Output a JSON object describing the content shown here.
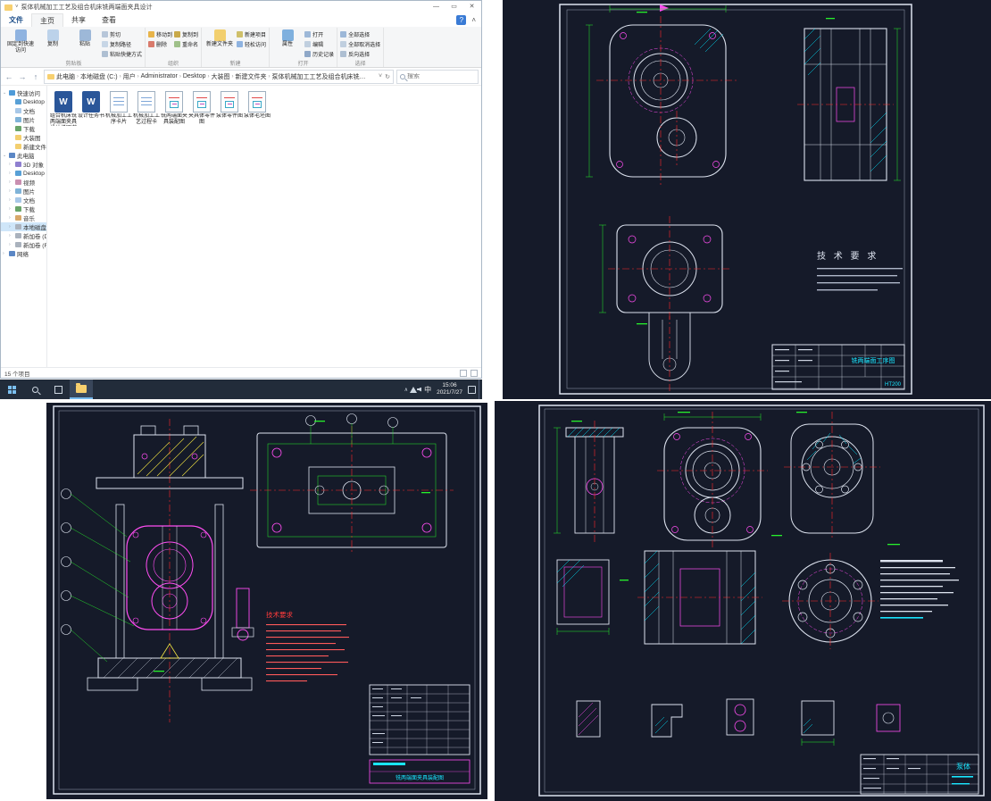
{
  "icons": {
    "minimize": "—",
    "maximize": "▭",
    "close": "✕",
    "back": "←",
    "forward": "→",
    "up": "↑",
    "refresh": "↻",
    "dropdown": "˅",
    "ribbon_collapse": "˄",
    "help": "?",
    "chevron": "›",
    "tray_arrow": "∧"
  },
  "window": {
    "title": "泵体机械加工工艺及组合机床铣两端面夹具设计"
  },
  "ribbon": {
    "file_tab": "文件",
    "tabs": [
      "主页",
      "共享",
      "查看"
    ],
    "clipboard": {
      "label": "剪贴板",
      "pin": "固定到快速访问",
      "copy": "复制",
      "paste": "粘贴",
      "cut": "剪切",
      "copy_path": "复制路径",
      "paste_shortcut": "粘贴快捷方式"
    },
    "organize": {
      "label": "组织",
      "move": "移动到",
      "copy_to": "复制到",
      "delete": "删除",
      "rename": "重命名"
    },
    "new": {
      "label": "新建",
      "new_folder": "新建文件夹",
      "new_item": "新建项目",
      "easy_access": "轻松访问"
    },
    "open": {
      "label": "打开",
      "properties": "属性",
      "open": "打开",
      "edit": "编辑",
      "history": "历史记录"
    },
    "select": {
      "label": "选择",
      "select_all": "全部选择",
      "select_none": "全部取消选择",
      "invert": "反向选择"
    }
  },
  "address": {
    "path": [
      "此电脑",
      "本地磁盘 (C:)",
      "用户",
      "Administrator",
      "Desktop",
      "大装图",
      "新建文件夹",
      "泵体机械加工工艺及组合机床铣两端面夹具设计"
    ],
    "search_placeholder": "搜索"
  },
  "nav": {
    "items": [
      {
        "label": "快速访问",
        "arr": "⌄"
      },
      {
        "label": "Desktop",
        "arr": ""
      },
      {
        "label": "文档",
        "arr": ""
      },
      {
        "label": "图片",
        "arr": ""
      },
      {
        "label": "下载",
        "arr": ""
      },
      {
        "label": "大装图",
        "arr": ""
      },
      {
        "label": "新建文件夹",
        "arr": ""
      },
      {
        "label": "此电脑",
        "arr": "⌄"
      },
      {
        "label": "3D 对象",
        "arr": "›"
      },
      {
        "label": "Desktop",
        "arr": "›"
      },
      {
        "label": "视频",
        "arr": "›"
      },
      {
        "label": "图片",
        "arr": "›"
      },
      {
        "label": "文档",
        "arr": "›"
      },
      {
        "label": "下载",
        "arr": "›"
      },
      {
        "label": "音乐",
        "arr": "›"
      },
      {
        "label": "本地磁盘 (C:)",
        "arr": "›"
      },
      {
        "label": "新加卷 (D:)",
        "arr": "›"
      },
      {
        "label": "新加卷 (F:)",
        "arr": "›"
      },
      {
        "label": "网络",
        "arr": "›"
      }
    ]
  },
  "files": [
    {
      "name": "组合机床铣两端面夹具设计说明书",
      "badge": "W"
    },
    {
      "name": "设计任务书",
      "badge": "W"
    },
    {
      "name": "机械加工工序卡片"
    },
    {
      "name": "机械加工工艺过程卡"
    },
    {
      "name": "铣两端面夹具装配图"
    },
    {
      "name": "夹具体零件图"
    },
    {
      "name": "泵体零件图"
    },
    {
      "name": "泵体毛坯图"
    }
  ],
  "statusbar": {
    "count": "15 个项目"
  },
  "taskbar": {
    "lang": "中",
    "time": "15:06",
    "date": "2021/7/27"
  },
  "cad": {
    "top_right": {
      "tech_title": "技 术 要 求",
      "title_name": "铣两端面工序图",
      "material": "HT200"
    },
    "bottom_left": {
      "notes_title": "技术要求",
      "title_name": "铣两端面夹具装配图"
    },
    "bottom_right": {
      "title_name": "泵体"
    }
  }
}
